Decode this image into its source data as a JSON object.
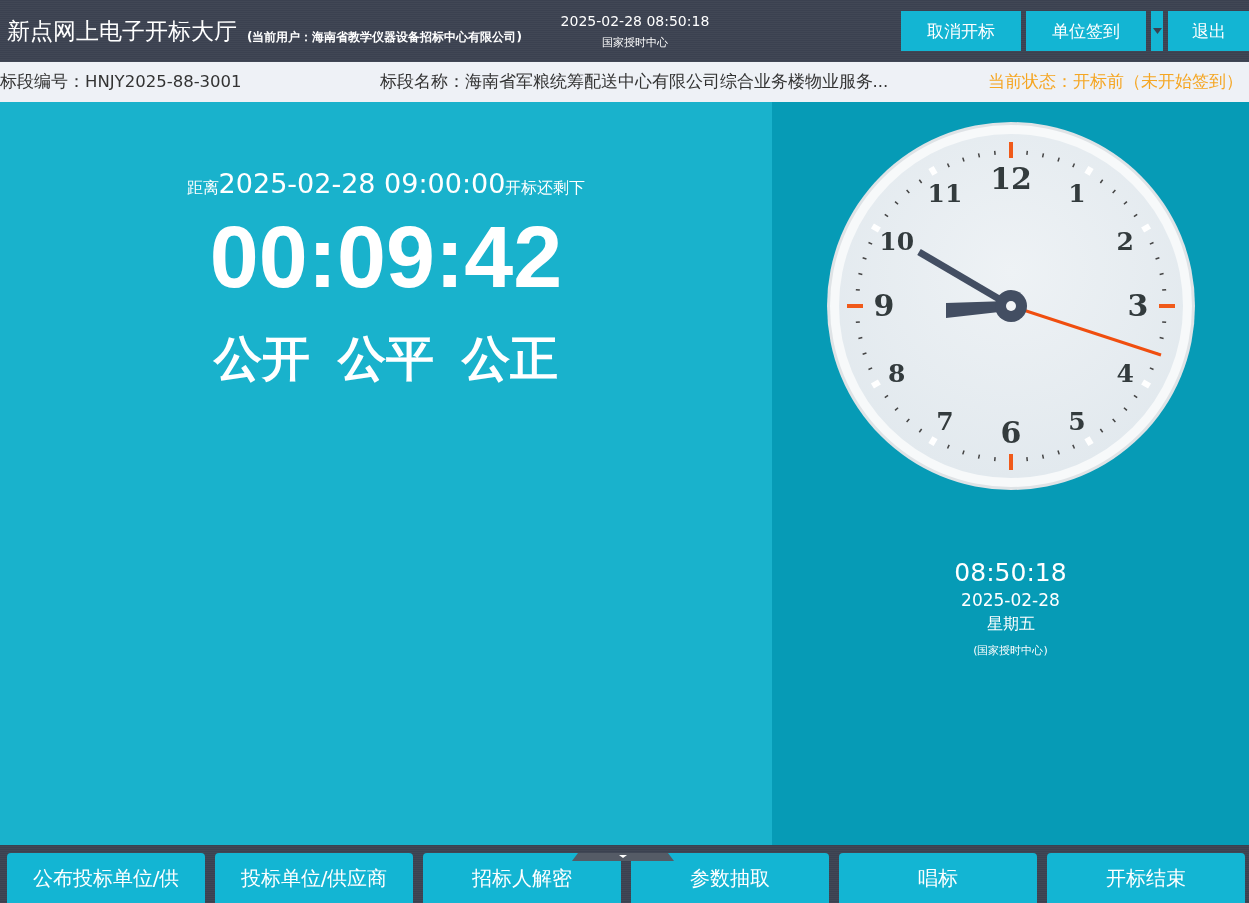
{
  "header": {
    "title": "新点网上电子开标大厅",
    "user": "(当前用户：海南省教学仪器设备招标中心有限公司)",
    "datetime": "2025-02-28 08:50:18",
    "time_source": "国家授时中心",
    "buttons": [
      {
        "kind": "button",
        "label": "取消开标"
      },
      {
        "kind": "button",
        "label": "单位签到"
      },
      {
        "kind": "dropdown"
      },
      {
        "kind": "button",
        "label": "退出"
      }
    ]
  },
  "info_bar": {
    "section_no": "标段编号：HNJY2025-88-3001",
    "section_name": "标段名称：海南省军粮统筹配送中心有限公司综合业务楼物业服务...",
    "status": "当前状态：开标前（未开始签到）"
  },
  "countdown": {
    "prefix": "距离",
    "target": "2025-02-28 09:00:00",
    "suffix": "开标还剩下",
    "remaining": "00:09:42",
    "motto": [
      "公开",
      "公平",
      "公正"
    ]
  },
  "clock": {
    "numbers": [
      "12",
      "11",
      "1",
      "10",
      "2",
      "9",
      "3",
      "8",
      "4",
      "7",
      "5",
      "6"
    ],
    "time": "08:50:18",
    "date": "2025-02-28",
    "weekday": "星期五",
    "source": "(国家授时中心)"
  },
  "steps": [
    "公布投标单位/供",
    "投标单位/供应商",
    "招标人解密",
    "参数抽取",
    "唱标",
    "开标结束"
  ]
}
